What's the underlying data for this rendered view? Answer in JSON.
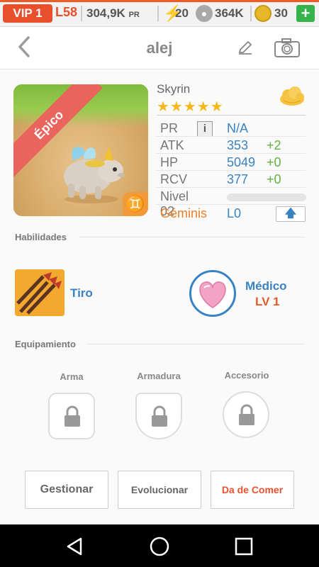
{
  "status": {
    "vip": "VIP 1",
    "level": "L58",
    "pr_amount": "304,9K",
    "pr_unit": "PR",
    "energy": "20",
    "paw_count": "364K",
    "gem_count": "30",
    "add_label": "+"
  },
  "header": {
    "back_icon": "chevron-left",
    "title": "alej",
    "edit_icon": "pencil",
    "camera_icon": "camera"
  },
  "monster": {
    "rarity": "Épico",
    "name": "Skyrin",
    "stars": "★★★★★",
    "star_count": 5,
    "stats": {
      "pr_label": "PR",
      "pr_value": "N/A",
      "atk_label": "ATK",
      "atk_value": "353",
      "atk_bonus": "+2",
      "hp_label": "HP",
      "hp_value": "5049",
      "hp_bonus": "+0",
      "rcv_label": "RCV",
      "rcv_value": "377",
      "rcv_bonus": "+0",
      "level_label": "Nivel 02",
      "sign_label": "Géminis",
      "sign_value": "L0"
    },
    "zodiac_symbol": "♊"
  },
  "skills": {
    "section_title": "Habilidades",
    "active_name": "Tiro",
    "leader_name": "Médico",
    "leader_level": "LV 1"
  },
  "equipment": {
    "section_title": "Equipamiento",
    "weapon": "Arma",
    "armor": "Armadura",
    "accessory": "Accesorio"
  },
  "buttons": {
    "manage": "Gestionar",
    "evolve": "Evolucionar",
    "feed": "Da de Comer"
  },
  "colors": {
    "accent_orange": "#e8502d",
    "value_blue": "#3a83c3",
    "bonus_green": "#61b23e",
    "star_yellow": "#f3b81b",
    "rarity_red": "#e9645c"
  }
}
